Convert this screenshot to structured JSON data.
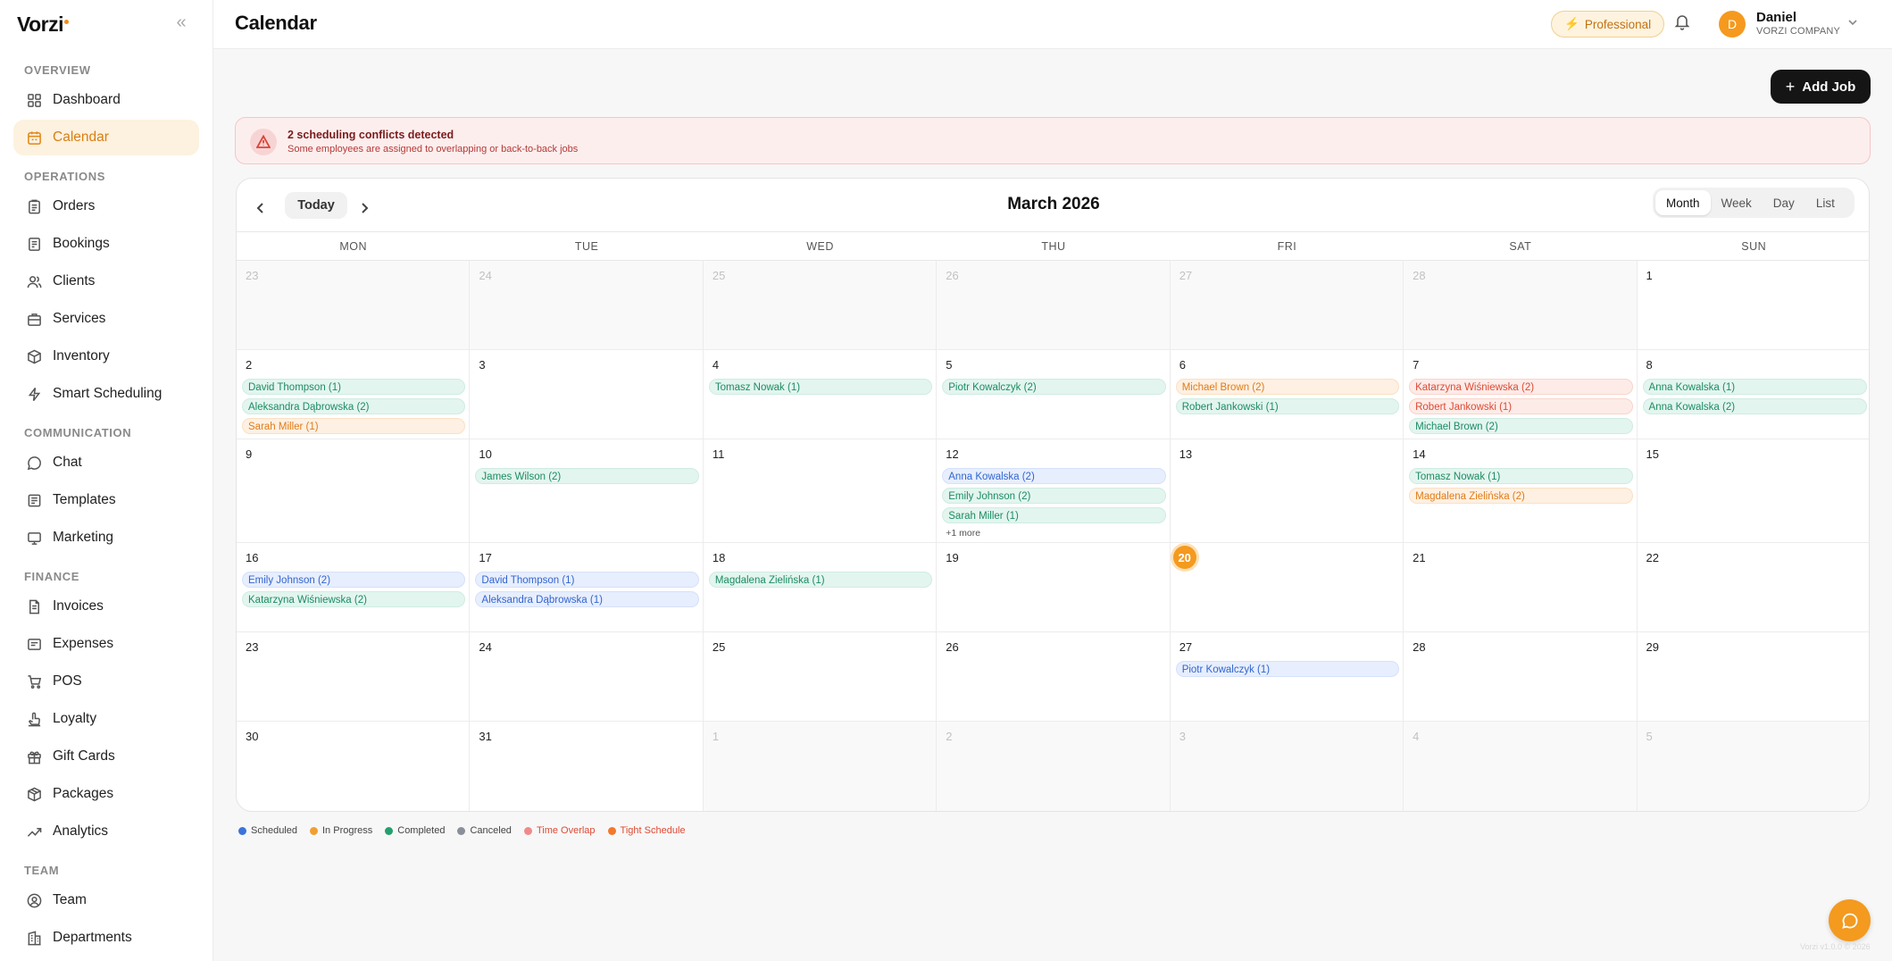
{
  "brand": {
    "name": "Vorzi"
  },
  "header": {
    "title": "Calendar",
    "plan_badge": "Professional",
    "user_name": "Daniel",
    "user_initial": "D",
    "user_company": "VORZI COMPANY"
  },
  "sidebar": {
    "sections": [
      "OVERVIEW",
      "OPERATIONS",
      "COMMUNICATION",
      "FINANCE",
      "TEAM"
    ],
    "items": [
      {
        "label": "Dashboard",
        "icon": "grid-icon"
      },
      {
        "label": "Calendar",
        "icon": "calendar-icon",
        "active": true
      },
      {
        "label": "Orders",
        "icon": "clipboard-icon"
      },
      {
        "label": "Bookings",
        "icon": "book-icon"
      },
      {
        "label": "Clients",
        "icon": "users-icon"
      },
      {
        "label": "Services",
        "icon": "briefcase-icon"
      },
      {
        "label": "Inventory",
        "icon": "box-icon"
      },
      {
        "label": "Smart Scheduling",
        "icon": "lightning-icon"
      },
      {
        "label": "Chat",
        "icon": "chat-icon"
      },
      {
        "label": "Templates",
        "icon": "template-icon"
      },
      {
        "label": "Marketing",
        "icon": "megaphone-icon"
      },
      {
        "label": "Invoices",
        "icon": "invoice-icon"
      },
      {
        "label": "Expenses",
        "icon": "receipt-icon"
      },
      {
        "label": "POS",
        "icon": "cart-icon"
      },
      {
        "label": "Loyalty",
        "icon": "loyalty-icon"
      },
      {
        "label": "Gift Cards",
        "icon": "gift-icon"
      },
      {
        "label": "Packages",
        "icon": "package-icon"
      },
      {
        "label": "Analytics",
        "icon": "trend-icon"
      },
      {
        "label": "Team",
        "icon": "user-circle-icon"
      },
      {
        "label": "Departments",
        "icon": "building-icon"
      }
    ]
  },
  "toolbar": {
    "add_job": "Add Job"
  },
  "alert": {
    "title": "2 scheduling conflicts detected",
    "subtitle": "Some employees are assigned to overlapping or back-to-back jobs"
  },
  "calendar": {
    "today_label": "Today",
    "month_title": "March 2026",
    "views": [
      "Month",
      "Week",
      "Day",
      "List"
    ],
    "active_view": "Month",
    "weekdays": [
      "MON",
      "TUE",
      "WED",
      "THU",
      "FRI",
      "SAT",
      "SUN"
    ],
    "weeks": [
      [
        {
          "d": "23",
          "other": true
        },
        {
          "d": "24",
          "other": true
        },
        {
          "d": "25",
          "other": true
        },
        {
          "d": "26",
          "other": true
        },
        {
          "d": "27",
          "other": true
        },
        {
          "d": "28",
          "other": true
        },
        {
          "d": "1"
        }
      ],
      [
        {
          "d": "2",
          "events": [
            {
              "t": "David Thompson (1)",
              "c": "green"
            },
            {
              "t": "Aleksandra Dąbrowska (2)",
              "c": "green"
            },
            {
              "t": "Sarah Miller (1)",
              "c": "orange"
            }
          ]
        },
        {
          "d": "3"
        },
        {
          "d": "4",
          "events": [
            {
              "t": "Tomasz Nowak (1)",
              "c": "green"
            }
          ]
        },
        {
          "d": "5",
          "events": [
            {
              "t": "Piotr Kowalczyk (2)",
              "c": "green"
            }
          ]
        },
        {
          "d": "6",
          "events": [
            {
              "t": "Michael Brown (2)",
              "c": "orange"
            },
            {
              "t": "Robert Jankowski (1)",
              "c": "green"
            }
          ]
        },
        {
          "d": "7",
          "events": [
            {
              "t": "Katarzyna Wiśniewska (2)",
              "c": "red"
            },
            {
              "t": "Robert Jankowski (1)",
              "c": "red"
            },
            {
              "t": "Michael Brown (2)",
              "c": "green"
            }
          ]
        },
        {
          "d": "8",
          "events": [
            {
              "t": "Anna Kowalska (1)",
              "c": "green"
            },
            {
              "t": "Anna Kowalska (2)",
              "c": "green"
            }
          ]
        }
      ],
      [
        {
          "d": "9"
        },
        {
          "d": "10",
          "events": [
            {
              "t": "James Wilson (2)",
              "c": "green"
            }
          ]
        },
        {
          "d": "11"
        },
        {
          "d": "12",
          "events": [
            {
              "t": "Anna Kowalska (2)",
              "c": "blue"
            },
            {
              "t": "Emily Johnson (2)",
              "c": "green"
            },
            {
              "t": "Sarah Miller (1)",
              "c": "green"
            }
          ],
          "more": "+1 more"
        },
        {
          "d": "13"
        },
        {
          "d": "14",
          "events": [
            {
              "t": "Tomasz Nowak (1)",
              "c": "green"
            },
            {
              "t": "Magdalena Zielińska (2)",
              "c": "orange"
            }
          ]
        },
        {
          "d": "15"
        }
      ],
      [
        {
          "d": "16",
          "events": [
            {
              "t": "Emily Johnson (2)",
              "c": "blue"
            },
            {
              "t": "Katarzyna Wiśniewska (2)",
              "c": "green"
            }
          ]
        },
        {
          "d": "17",
          "events": [
            {
              "t": "David Thompson (1)",
              "c": "blue"
            },
            {
              "t": "Aleksandra Dąbrowska (1)",
              "c": "blue"
            }
          ]
        },
        {
          "d": "18",
          "events": [
            {
              "t": "Magdalena Zielińska (1)",
              "c": "green"
            }
          ]
        },
        {
          "d": "19"
        },
        {
          "d": "20",
          "today": true
        },
        {
          "d": "21"
        },
        {
          "d": "22"
        }
      ],
      [
        {
          "d": "23"
        },
        {
          "d": "24"
        },
        {
          "d": "25"
        },
        {
          "d": "26"
        },
        {
          "d": "27",
          "events": [
            {
              "t": "Piotr Kowalczyk (1)",
              "c": "blue"
            }
          ]
        },
        {
          "d": "28"
        },
        {
          "d": "29"
        }
      ],
      [
        {
          "d": "30"
        },
        {
          "d": "31"
        },
        {
          "d": "1",
          "other": true
        },
        {
          "d": "2",
          "other": true
        },
        {
          "d": "3",
          "other": true
        },
        {
          "d": "4",
          "other": true
        },
        {
          "d": "5",
          "other": true
        }
      ]
    ]
  },
  "legend": [
    {
      "label": "Scheduled",
      "color": "#3b73db"
    },
    {
      "label": "In Progress",
      "color": "#f0a030"
    },
    {
      "label": "Completed",
      "color": "#23a06e"
    },
    {
      "label": "Canceled",
      "color": "#8a8f99"
    },
    {
      "label": "Time Overlap",
      "color": "#ef8a8a",
      "warn": true
    },
    {
      "label": "Tight Schedule",
      "color": "#f2782a",
      "warn": true
    }
  ],
  "footer": {
    "version": "Vorzi v1.0.0 © 2026"
  }
}
